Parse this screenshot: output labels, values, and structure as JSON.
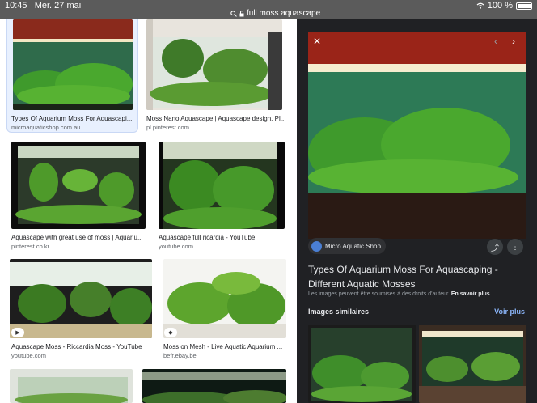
{
  "status_bar": {
    "time": "10:45",
    "date": "Mer. 27 mai",
    "url": "full moss aquascape",
    "battery": "100 %"
  },
  "results": [
    {
      "caption": "Types Of Aquarium Moss For Aquascapi...",
      "source": "microaquaticshop.com.au"
    },
    {
      "caption": "Moss Nano Aquascape | Aquascape design, Pl...",
      "source": "pl.pinterest.com"
    },
    {
      "caption": "Aquascape with great use of moss | Aquariu...",
      "source": "pinterest.co.kr"
    },
    {
      "caption": "Aquascape full ricardia - YouTube",
      "source": "youtube.com"
    },
    {
      "caption": "Aquascape Moss - Riccardia Moss - YouTube",
      "source": "youtube.com"
    },
    {
      "caption": "Moss on Mesh - Live Aquatic Aquarium ...",
      "source": "befr.ebay.be"
    }
  ],
  "panel": {
    "close_icon": "close-icon",
    "site_name": "Micro Aquatic Shop",
    "title": "Types Of Aquarium Moss For Aquascaping - Different Aquatic Mosses",
    "copyright_note": "Les images peuvent être soumises à des droits d'auteur.",
    "learn_more": "En savoir plus",
    "similar_heading": "Images similaires",
    "see_more": "Voir plus"
  },
  "colors": {
    "panel_bg": "#202124",
    "link_blue": "#8ab4f8",
    "selected_bg": "#e8f0fe",
    "status_bar": "#5b5b5b"
  }
}
